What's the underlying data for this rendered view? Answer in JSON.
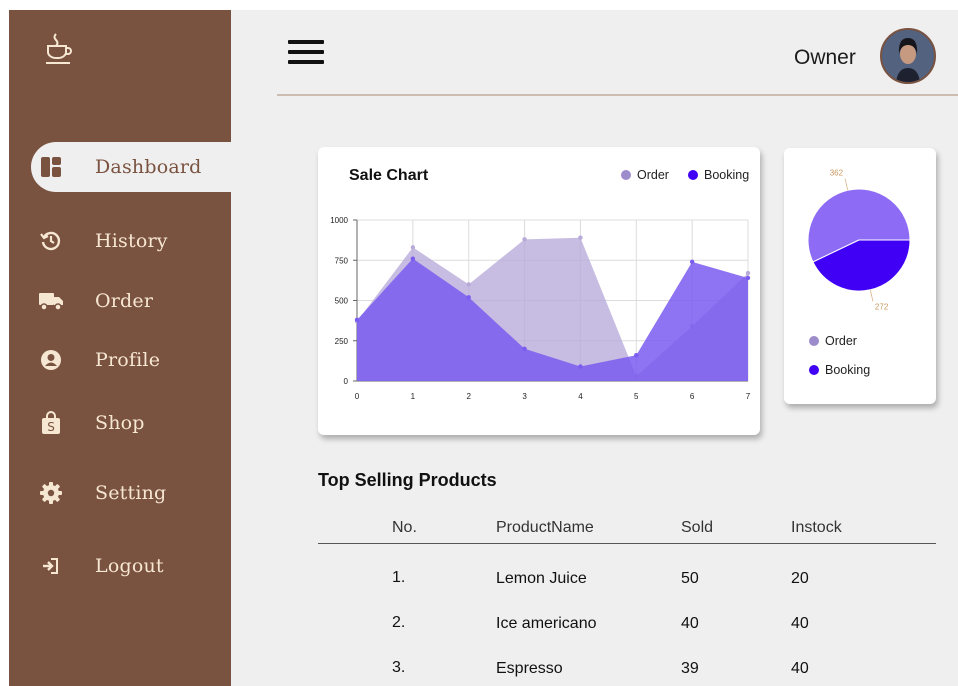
{
  "sidebar": {
    "items": [
      {
        "label": "Dashboard",
        "icon": "dashboard-icon",
        "active": true
      },
      {
        "label": "History",
        "icon": "history-icon"
      },
      {
        "label": "Order",
        "icon": "truck-icon"
      },
      {
        "label": "Profile",
        "icon": "user-circle-icon"
      },
      {
        "label": "Shop",
        "icon": "shopping-bag-icon"
      },
      {
        "label": "Setting",
        "icon": "gear-icon"
      },
      {
        "label": "Logout",
        "icon": "logout-icon"
      }
    ],
    "logo_icon": "coffee-cup-icon"
  },
  "header": {
    "user_label": "Owner",
    "menu_icon": "hamburger-menu-icon"
  },
  "colors": {
    "sidebar_bg": "#7a5240",
    "order": "#9d8ccc",
    "booking": "#3f00f5"
  },
  "sale_chart": {
    "title": "Sale Chart",
    "legend": [
      "Order",
      "Booking"
    ]
  },
  "pie_chart": {
    "legend": [
      "Order",
      "Booking"
    ]
  },
  "chart_data": [
    {
      "type": "area",
      "title": "Sale Chart",
      "x": [
        0,
        1,
        2,
        3,
        4,
        5,
        6,
        7
      ],
      "xlim": [
        0,
        7
      ],
      "ylim": [
        0,
        1000
      ],
      "yticks": [
        0,
        250,
        500,
        750,
        1000
      ],
      "grid": true,
      "legend_position": "top-right",
      "series": [
        {
          "name": "Order",
          "color": "#b7a9d8",
          "values": [
            370,
            830,
            600,
            880,
            890,
            30,
            340,
            670
          ]
        },
        {
          "name": "Booking",
          "color": "#7a5cf0",
          "values": [
            380,
            760,
            520,
            200,
            90,
            160,
            740,
            640
          ]
        }
      ]
    },
    {
      "type": "pie",
      "labels": [
        "Order",
        "Booking"
      ],
      "values": [
        362,
        272
      ],
      "colors": [
        "#8d6bf5",
        "#3f00f5"
      ],
      "legend_position": "bottom"
    }
  ],
  "top_selling": {
    "title": "Top Selling Products",
    "columns": [
      "No.",
      "ProductName",
      "Sold",
      "Instock"
    ],
    "rows": [
      [
        "1.",
        "Lemon Juice",
        "50",
        "20"
      ],
      [
        "2.",
        "Ice americano",
        "40",
        "40"
      ],
      [
        "3.",
        "Espresso",
        "39",
        "40"
      ]
    ]
  }
}
